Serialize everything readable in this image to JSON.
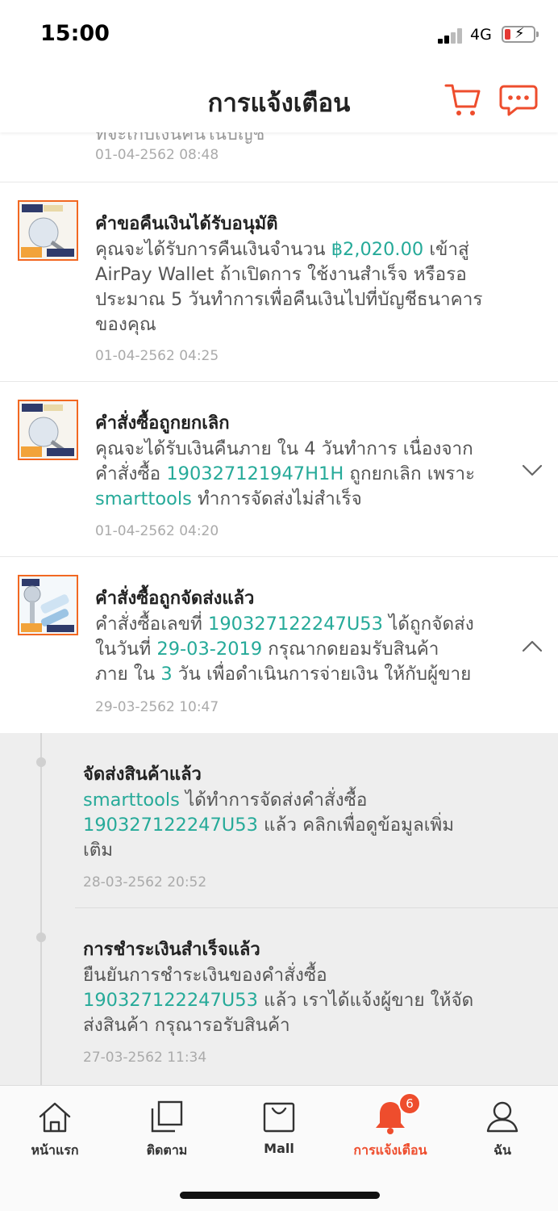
{
  "status_bar": {
    "time": "15:00",
    "network": "4G"
  },
  "header": {
    "title": "การแจ้งเตือน"
  },
  "truncated_item": {
    "message": "ที่จะเก็บเงินคืนในบัญชี",
    "date": "01-04-2562 08:48"
  },
  "notifications": [
    {
      "title": "คำขอคืนเงินได้รับอนุมัติ",
      "line1_a": "คุณจะได้รับการคืนเงินจำนวน ",
      "amount": "฿2,020.00",
      "line1_b": " เข้าสู่",
      "line2": "AirPay Wallet ถ้าเปิดการ ใช้งานสำเร็จ หรือรอ",
      "line3": "ประมาณ 5 วันทำการเพื่อคืนเงินไปที่บัญชีธนาคาร",
      "line4": "ของคุณ",
      "date": "01-04-2562 04:25"
    },
    {
      "title": "คำสั่งซื้อถูกยกเลิก",
      "line1": "คุณจะได้รับเงินคืนภาย ใน 4 วันทำการ เนื่องจาก",
      "line2_a": "คำสั่งซื้อ ",
      "order_id": "190327121947H1H",
      "line2_b": " ถูกยกเลิก เพราะ",
      "shop": "smarttools",
      "line3_b": " ทำการจัดส่งไม่สำเร็จ",
      "date": "01-04-2562 04:20"
    },
    {
      "title": "คำสั่งซื้อถูกจัดส่งแล้ว",
      "line1_a": "คำสั่งซื้อเลขที่ ",
      "order_id": "190327122247U53",
      "line1_b": " ได้ถูกจัดส่ง",
      "line2_a": "ในวันที่ ",
      "ship_date": "29-03-2019",
      "line2_b": " กรุณากดยอมรับสินค้า",
      "line3_a": "ภาย ใน ",
      "days": "3",
      "line3_b": " วัน เพื่อดำเนินการจ่ายเงิน ให้กับผู้ขาย",
      "date": "29-03-2562 10:47"
    }
  ],
  "sub_updates": [
    {
      "title": "จัดส่งสินค้าแล้ว",
      "shop": "smarttools",
      "line1_b": " ได้ทำการจัดส่งคำสั่งซื้อ",
      "order_id": "190327122247U53",
      "line2_b": " แล้ว คลิกเพื่อดูข้อมูลเพิ่ม",
      "line3": "เติม",
      "date": "28-03-2562 20:52"
    },
    {
      "title": "การชำระเงินสำเร็จแล้ว",
      "line1": "ยืนยันการชำระเงินของคำสั่งซื้อ",
      "order_id": "190327122247U53",
      "line2_b": " แล้ว เราได้แจ้งผู้ขาย ให้จัด",
      "line3": "ส่งสินค้า กรุณารอรับสินค้า",
      "date": "27-03-2562 11:34"
    }
  ],
  "tabbar": {
    "items": [
      {
        "label": "หน้าแรก",
        "icon": "home-icon"
      },
      {
        "label": "ติดตาม",
        "icon": "feed-icon"
      },
      {
        "label": "Mall",
        "icon": "mall-bag-icon"
      },
      {
        "label": "การแจ้งเตือน",
        "icon": "bell-icon",
        "active": true,
        "badge": "6"
      },
      {
        "label": "ฉัน",
        "icon": "profile-icon"
      }
    ]
  },
  "colors": {
    "accent": "#ee4d2d",
    "link": "#26aa99",
    "sub_bg": "#eeeeee"
  }
}
